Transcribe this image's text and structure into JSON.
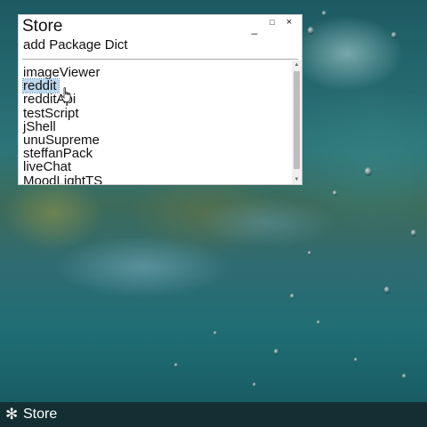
{
  "window": {
    "title": "Store",
    "subtitle": "add Package Dict",
    "controls": {
      "minimize": "_",
      "maximize": "□",
      "close": "×"
    }
  },
  "packages": {
    "items": [
      "imageViewer",
      "reddit",
      "redditApi",
      "testScript",
      "jShell",
      "unuSupreme",
      "steffanPack",
      "liveChat",
      "MoodLightTS"
    ],
    "selected": "reddit"
  },
  "taskbar": {
    "items": [
      {
        "label": "Store",
        "icon": "gear-icon"
      }
    ]
  },
  "colors": {
    "selection": "#bcd8ee",
    "taskbar": "#14282c"
  }
}
